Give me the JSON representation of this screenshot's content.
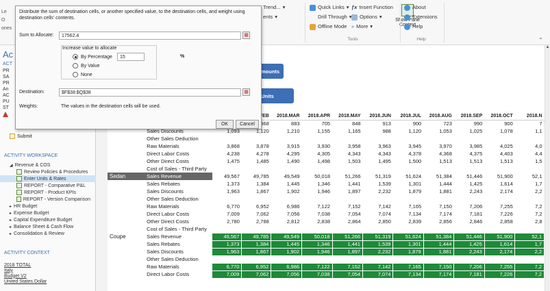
{
  "ribbon": {
    "trend": "Trend...",
    "events": "ents",
    "quick_links": "Quick Links",
    "insert_function": "Insert Function",
    "drill_through": "Drill Through",
    "options": "Options",
    "offline_mode": "Offline Mode",
    "more": "More",
    "show_pane": "Show Pane",
    "context": "Context",
    "about": "About",
    "extensions": "Extensions",
    "help": "Help",
    "tools_label": "Tools",
    "help_label": "Help",
    "left_letters": [
      "Le",
      "O",
      "ones"
    ]
  },
  "dialog": {
    "description": "Distribute the sum of destination cells, or another specified value, to the destination cells, and weight using destination cells' contents.",
    "sum_label": "Sum to Allocate:",
    "sum_value": "17562.4",
    "increase_label": "Increase value to allocate",
    "by_percentage": "By Percentage",
    "percentage_value": "15",
    "percent_sign": "%",
    "by_value": "By Value",
    "none": "None",
    "destination_label": "Destination:",
    "destination_value": "$F$38:$Q$38",
    "weights_label": "Weights:",
    "weights_text": "The values in the destination cells will be used.",
    "ok": "OK",
    "cancel": "Cancel"
  },
  "left_panel": {
    "letters": [
      "Ac",
      "ACT",
      "PR",
      "SA",
      "PR",
      "An",
      "AC",
      "PU",
      "ST"
    ],
    "submit": "Submit",
    "activity_workspace": "ACTIVITY WORKSPACE",
    "items": [
      {
        "label": "Revenue & COS",
        "level": 1,
        "selected": false
      },
      {
        "label": "Review Policies & Procedures",
        "level": 2,
        "selected": false
      },
      {
        "label": "Enter Units & Rates",
        "level": 2,
        "selected": true
      },
      {
        "label": "REPORT - Comparative P&L",
        "level": 2,
        "selected": false
      },
      {
        "label": "REPORT - Product KPIs",
        "level": 2,
        "selected": false
      },
      {
        "label": "REPORT - Version Comparison",
        "level": 2,
        "selected": false
      },
      {
        "label": "HR Budget",
        "level": 1,
        "selected": false
      },
      {
        "label": "Expense Budget",
        "level": 1,
        "selected": false
      },
      {
        "label": "Capital Expenditure Budget",
        "level": 1,
        "selected": false
      },
      {
        "label": "Balance Sheet & Cash Flow",
        "level": 1,
        "selected": false
      },
      {
        "label": "Consolidation & Review",
        "level": 1,
        "selected": false
      }
    ],
    "activity_context": "ACTIVITY CONTEXT",
    "context_items": [
      "2018 TOTAL",
      "Italy",
      "Budget V2",
      "United States Dollar"
    ]
  },
  "buttons": {
    "amounts": "mounts",
    "units": "Units"
  },
  "grid": {
    "columns": [
      "FEB",
      "2018.MAR",
      "2018.APR",
      "2018.MAY",
      "2018.JUN",
      "2018.JUL",
      "2018.AUG",
      "2018.SEP",
      "2018.OCT",
      "2018.N"
    ],
    "rows": [
      {
        "product": "",
        "account": "",
        "values": [
          "868",
          "883",
          "705",
          "848",
          "913",
          "900",
          "723",
          "990",
          "900",
          "7"
        ],
        "style": "plain"
      },
      {
        "product": "",
        "account": "Sales Discounts",
        "values": [
          "1,093",
          "1,120",
          "1,210",
          "1,155",
          "1,165",
          "988",
          "1,120",
          "1,053",
          "1,025",
          "1,078",
          "1,1"
        ],
        "style": "plain",
        "extra_left": true
      },
      {
        "product": "",
        "account": "Other Sales Deduction",
        "values": [],
        "style": "plain"
      },
      {
        "product": "",
        "account": "Raw Materials",
        "values": [
          "3,868",
          "3,878",
          "3,915",
          "3,930",
          "3,958",
          "3,963",
          "3,945",
          "3,970",
          "3,985",
          "4,025",
          "4,0"
        ],
        "style": "plain",
        "extra_left": true
      },
      {
        "product": "",
        "account": "Direct Labor Costs",
        "values": [
          "4,238",
          "4,278",
          "4,295",
          "4,305",
          "4,343",
          "4,343",
          "4,378",
          "4,368",
          "4,375",
          "4,403",
          "4,4"
        ],
        "style": "plain",
        "extra_left": true
      },
      {
        "product": "",
        "account": "Other Direct Costs",
        "values": [
          "1,475",
          "1,485",
          "1,490",
          "1,498",
          "1,503",
          "1,495",
          "1,500",
          "1,513",
          "1,513",
          "1,513",
          "1,5"
        ],
        "style": "plain",
        "extra_left": true
      },
      {
        "product": "",
        "account": "Cost of Sales - Third Party",
        "values": [],
        "style": "plain"
      },
      {
        "product": "Sedan",
        "account": "Sales Revenue",
        "values": [
          "49,567",
          "49,785",
          "49,549",
          "50,018",
          "51,266",
          "51,319",
          "51,624",
          "51,384",
          "51,446",
          "51,900",
          "52,1"
        ],
        "style": "dark",
        "extra_left": true
      },
      {
        "product": "",
        "account": "Sales Rebates",
        "values": [
          "1,373",
          "1,384",
          "1,445",
          "1,346",
          "1,441",
          "1,539",
          "1,301",
          "1,444",
          "1,425",
          "1,614",
          "1,7"
        ],
        "style": "plain",
        "extra_left": true
      },
      {
        "product": "",
        "account": "Sales Discounts",
        "values": [
          "1,963",
          "1,867",
          "1,902",
          "1,946",
          "1,897",
          "2,232",
          "1,879",
          "1,881",
          "2,243",
          "2,174",
          "2,2"
        ],
        "style": "plain",
        "extra_left": true
      },
      {
        "product": "",
        "account": "Other Sales Deduction",
        "values": [],
        "style": "plain"
      },
      {
        "product": "",
        "account": "Raw Materials",
        "values": [
          "6,770",
          "6,952",
          "6,986",
          "7,122",
          "7,152",
          "7,142",
          "7,165",
          "7,150",
          "7,206",
          "7,255",
          "7,2"
        ],
        "style": "plain",
        "extra_left": true
      },
      {
        "product": "",
        "account": "Direct Labor Costs",
        "values": [
          "7,009",
          "7,062",
          "7,056",
          "7,038",
          "7,054",
          "7,074",
          "7,134",
          "7,174",
          "7,181",
          "7,226",
          "7,2"
        ],
        "style": "plain",
        "extra_left": true
      },
      {
        "product": "",
        "account": "Other Direct Costs",
        "values": [
          "2,780",
          "2,788",
          "2,812",
          "2,838",
          "2,864",
          "2,850",
          "2,839",
          "2,856",
          "2,846",
          "2,858",
          "2,8"
        ],
        "style": "plain",
        "extra_left": true
      },
      {
        "product": "",
        "account": "Cost of Sales - Third Party",
        "values": [],
        "style": "plain"
      },
      {
        "product": "Coupe",
        "account": "Sales Revenue",
        "values": [
          "49,567",
          "49,785",
          "49,549",
          "50,018",
          "51,266",
          "51,319",
          "51,624",
          "51,384",
          "51,446",
          "51,900",
          "52,1"
        ],
        "style": "green",
        "extra_left": true
      },
      {
        "product": "",
        "account": "Sales Rebates",
        "values": [
          "1,373",
          "1,384",
          "1,445",
          "1,346",
          "1,441",
          "1,539",
          "1,301",
          "1,444",
          "1,425",
          "1,614",
          "1,7"
        ],
        "style": "green-hl",
        "extra_left": true
      },
      {
        "product": "",
        "account": "Sales Discounts",
        "values": [
          "1,963",
          "1,867",
          "1,902",
          "1,946",
          "1,897",
          "2,232",
          "1,879",
          "1,881",
          "2,243",
          "2,174",
          "2,2"
        ],
        "style": "green",
        "extra_left": true
      },
      {
        "product": "",
        "account": "Other Sales Deduction",
        "values": [],
        "style": "plain"
      },
      {
        "product": "",
        "account": "Raw Materials",
        "values": [
          "6,770",
          "6,952",
          "6,986",
          "7,122",
          "7,152",
          "7,142",
          "7,165",
          "7,150",
          "7,206",
          "7,255",
          "7,2"
        ],
        "style": "green",
        "extra_left": true
      },
      {
        "product": "",
        "account": "Direct Labor Costs",
        "values": [
          "7,009",
          "7,062",
          "7,056",
          "7,038",
          "7,054",
          "7,074",
          "7,134",
          "7,174",
          "7,181",
          "7,226",
          "7,2"
        ],
        "style": "green",
        "extra_left": true
      }
    ]
  },
  "colors": {
    "green": "#1e8a3a",
    "dark": "#666666",
    "button_blue": "#3d6fb6",
    "selected": "#cfe3f7"
  }
}
